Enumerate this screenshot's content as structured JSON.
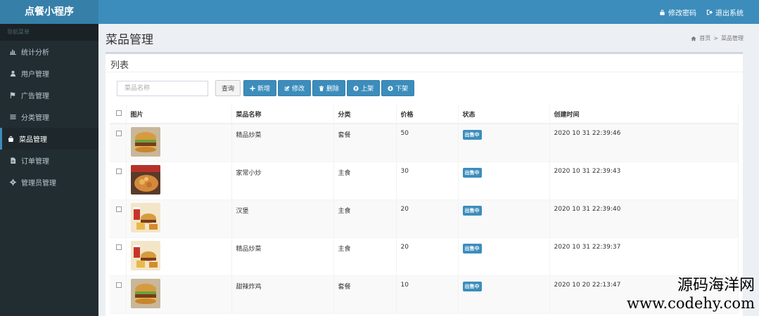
{
  "app": {
    "title": "点餐小程序"
  },
  "topbar": {
    "change_password": "修改密码",
    "logout": "退出系统"
  },
  "sidebar": {
    "header": "导航菜单",
    "items": [
      {
        "label": "统计分析",
        "icon": "bar-chart-icon"
      },
      {
        "label": "用户管理",
        "icon": "user-icon"
      },
      {
        "label": "广告管理",
        "icon": "flag-icon"
      },
      {
        "label": "分类管理",
        "icon": "list-icon"
      },
      {
        "label": "菜品管理",
        "icon": "shopping-bag-icon",
        "active": true
      },
      {
        "label": "订单管理",
        "icon": "file-icon"
      },
      {
        "label": "管理员管理",
        "icon": "gear-icon"
      }
    ]
  },
  "page": {
    "title": "菜品管理",
    "breadcrumb": [
      "首页",
      "菜品管理"
    ]
  },
  "box": {
    "title": "列表",
    "search_placeholder": "菜品名称",
    "query_label": "查询",
    "add_label": "新增",
    "edit_label": "修改",
    "delete_label": "删除",
    "on_shelf_label": "上架",
    "off_shelf_label": "下架"
  },
  "table": {
    "headers": [
      "图片",
      "菜品名称",
      "分类",
      "价格",
      "状态",
      "创建时间"
    ],
    "rows": [
      {
        "name": "精品炒菜",
        "category": "套餐",
        "price": "50",
        "status": "出售中",
        "created": "2020 10 31 22:39:46",
        "thumb": "burger"
      },
      {
        "name": "家常小炒",
        "category": "主食",
        "price": "30",
        "status": "出售中",
        "created": "2020 10 31 22:39:43",
        "thumb": "dish"
      },
      {
        "name": "汉堡",
        "category": "主食",
        "price": "20",
        "status": "出售中",
        "created": "2020 10 31 22:39:40",
        "thumb": "combo"
      },
      {
        "name": "精品炒菜",
        "category": "主食",
        "price": "20",
        "status": "出售中",
        "created": "2020 10 31 22:39:37",
        "thumb": "combo"
      },
      {
        "name": "甜辣炸鸡",
        "category": "套餐",
        "price": "10",
        "status": "出售中",
        "created": "2020 10 20 22:13:47",
        "thumb": "burger"
      }
    ]
  },
  "watermark": {
    "line1": "源码海洋网",
    "line2": "www.codehy.com"
  },
  "colors": {
    "header": "#3c8dbc",
    "brand": "#367fa9",
    "sidebar": "#222d32",
    "primary_button": "#3c8dbc",
    "badge": "#3c8dbc"
  }
}
